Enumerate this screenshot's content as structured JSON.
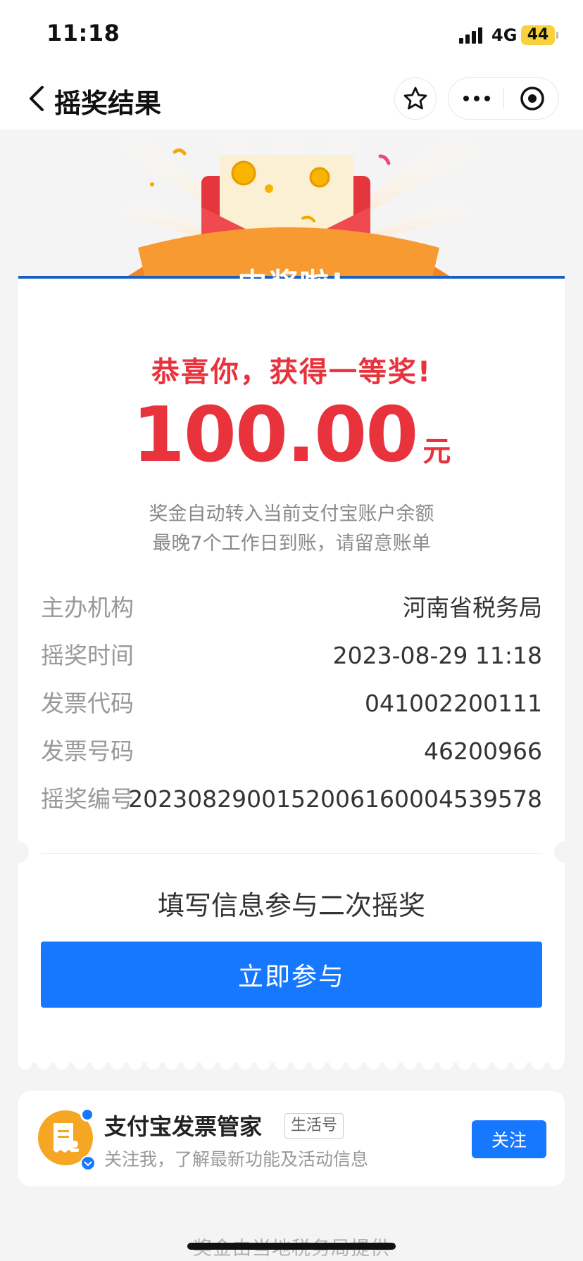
{
  "status_bar": {
    "time": "11:18",
    "network": "4G",
    "battery": "44"
  },
  "nav": {
    "title": "摇奖结果",
    "icons": [
      "back-icon",
      "star-icon",
      "more-icon",
      "close-target-icon"
    ]
  },
  "hero": {
    "banner_text": "中奖啦!"
  },
  "result": {
    "congrats": "恭喜你，获得一等奖!",
    "amount": "100.00",
    "unit": "元",
    "note_line1": "奖金自动转入当前支付宝账户余额",
    "note_line2": "最晚7个工作日到账，请留意账单"
  },
  "details": [
    {
      "label": "主办机构",
      "value": "河南省税务局"
    },
    {
      "label": "摇奖时间",
      "value": "2023-08-29 11:18"
    },
    {
      "label": "发票代码",
      "value": "041002200111"
    },
    {
      "label": "发票号码",
      "value": "46200966"
    },
    {
      "label": "摇奖编号",
      "value": "2023082900152006160004539578"
    }
  ],
  "second_draw": {
    "title": "填写信息参与二次摇奖",
    "button": "立即参与"
  },
  "account": {
    "name": "支付宝发票管家",
    "tag": "生活号",
    "desc": "关注我，了解最新功能及活动信息",
    "follow": "关注"
  },
  "footer": "奖金由当地税务局提供",
  "colors": {
    "accent_red": "#e8323c",
    "primary_blue": "#1677ff",
    "ribbon_orange": "#f7902c"
  }
}
